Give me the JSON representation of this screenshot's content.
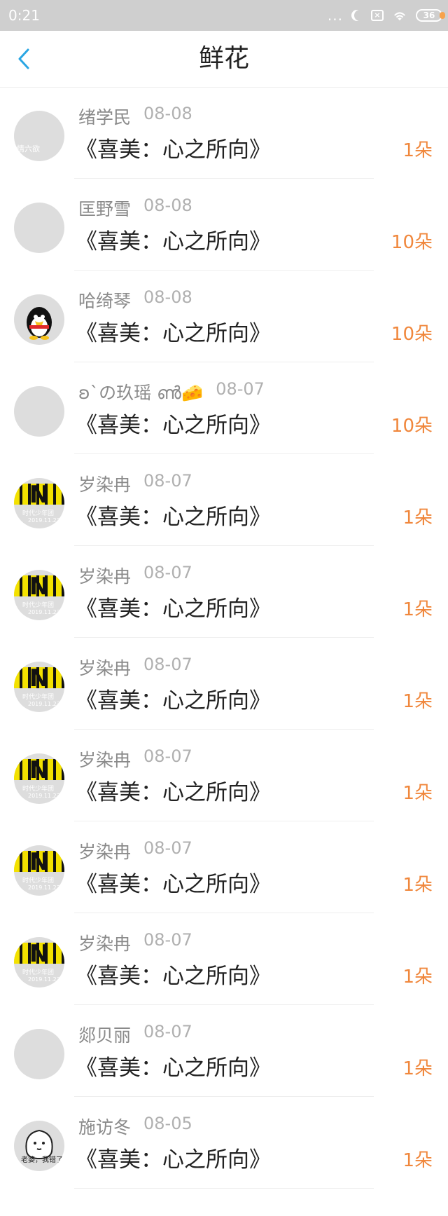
{
  "status_bar": {
    "time": "0:21",
    "dots": "...",
    "battery": "36"
  },
  "header": {
    "title": "鲜花"
  },
  "items": [
    {
      "name": "绪学民",
      "date": "08-08",
      "book": "《喜美：心之所向》",
      "count": "1朵",
      "avatar": "landscape",
      "avatar_text": "情六欲"
    },
    {
      "name": "匡野雪",
      "date": "08-08",
      "book": "《喜美：心之所向》",
      "count": "10朵",
      "avatar": "girl"
    },
    {
      "name": "哈绮琴",
      "date": "08-08",
      "book": "《喜美：心之所向》",
      "count": "10朵",
      "avatar": "qq"
    },
    {
      "name": "ʚ`の玖瑶 ൺ🧀",
      "date": "08-07",
      "book": "《喜美：心之所向》",
      "count": "10朵",
      "avatar": "anime"
    },
    {
      "name": "岁染冉",
      "date": "08-07",
      "book": "《喜美：心之所向》",
      "count": "1朵",
      "avatar": "n",
      "avatar_text1": "时代少年团",
      "avatar_text2": "2019.11.23"
    },
    {
      "name": "岁染冉",
      "date": "08-07",
      "book": "《喜美：心之所向》",
      "count": "1朵",
      "avatar": "n",
      "avatar_text1": "时代少年团",
      "avatar_text2": "2019.11.23"
    },
    {
      "name": "岁染冉",
      "date": "08-07",
      "book": "《喜美：心之所向》",
      "count": "1朵",
      "avatar": "n",
      "avatar_text1": "时代少年团",
      "avatar_text2": "2019.11.23"
    },
    {
      "name": "岁染冉",
      "date": "08-07",
      "book": "《喜美：心之所向》",
      "count": "1朵",
      "avatar": "n",
      "avatar_text1": "时代少年团",
      "avatar_text2": "2019.11.23"
    },
    {
      "name": "岁染冉",
      "date": "08-07",
      "book": "《喜美：心之所向》",
      "count": "1朵",
      "avatar": "n",
      "avatar_text1": "时代少年团",
      "avatar_text2": "2019.11.23"
    },
    {
      "name": "岁染冉",
      "date": "08-07",
      "book": "《喜美：心之所向》",
      "count": "1朵",
      "avatar": "n",
      "avatar_text1": "时代少年团",
      "avatar_text2": "2019.11.23"
    },
    {
      "name": "郯贝丽",
      "date": "08-07",
      "book": "《喜美：心之所向》",
      "count": "1朵",
      "avatar": "flower"
    },
    {
      "name": "施访冬",
      "date": "08-05",
      "book": "《喜美：心之所向》",
      "count": "1朵",
      "avatar": "cartoon",
      "avatar_text": "老婆，我错了"
    }
  ],
  "colors": {
    "accent_count": "#f0873c",
    "back_arrow": "#2aa6e3",
    "status_bar": "#cfcfcf"
  }
}
